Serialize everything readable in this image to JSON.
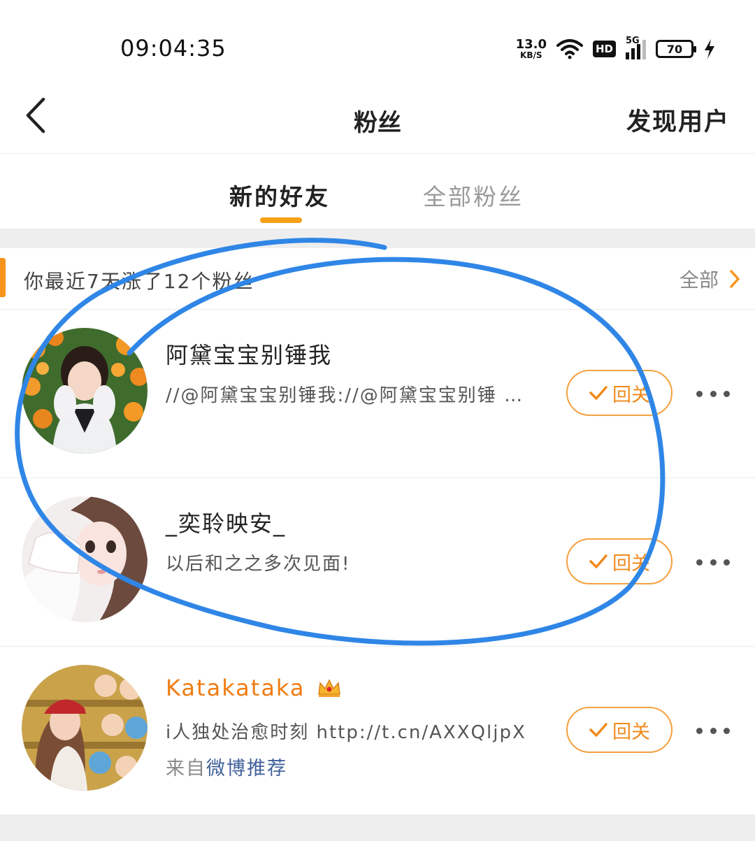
{
  "status_bar": {
    "time": "09:04:35",
    "net_speed_value": "13.0",
    "net_speed_unit": "KB/S",
    "hd_label": "HD",
    "network_type": "5G",
    "battery": "70"
  },
  "nav": {
    "title": "粉丝",
    "right_action": "发现用户"
  },
  "tabs": [
    {
      "label": "新的好友",
      "active": true
    },
    {
      "label": "全部粉丝",
      "active": false
    }
  ],
  "summary": {
    "text": "你最近7天涨了12个粉丝",
    "all_label": "全部"
  },
  "users": [
    {
      "name": "阿黛宝宝别锤我",
      "description": "//@阿黛宝宝别锤我://@阿黛宝宝别锤 …",
      "follow_label": "回关"
    },
    {
      "name": "_奕聆映安_",
      "description": "以后和之之多次见面!",
      "follow_label": "回关"
    },
    {
      "name": "Katakataka",
      "description": "i人独处治愈时刻 http://t.cn/AXXQljpX",
      "from_prefix": "来自",
      "from_link": "微博推荐",
      "follow_label": "回关"
    }
  ],
  "colors": {
    "accent": "#f7941d",
    "follow_border": "#f4a140",
    "vip_name": "#f07c12",
    "link": "#41609a",
    "annotation_stroke": "#2f86e6"
  },
  "icons": [
    "back-arrow-icon",
    "wifi-icon",
    "signal-icon",
    "battery-icon",
    "charging-icon",
    "chevron-right-icon",
    "check-icon",
    "more-icon",
    "crown-icon"
  ]
}
